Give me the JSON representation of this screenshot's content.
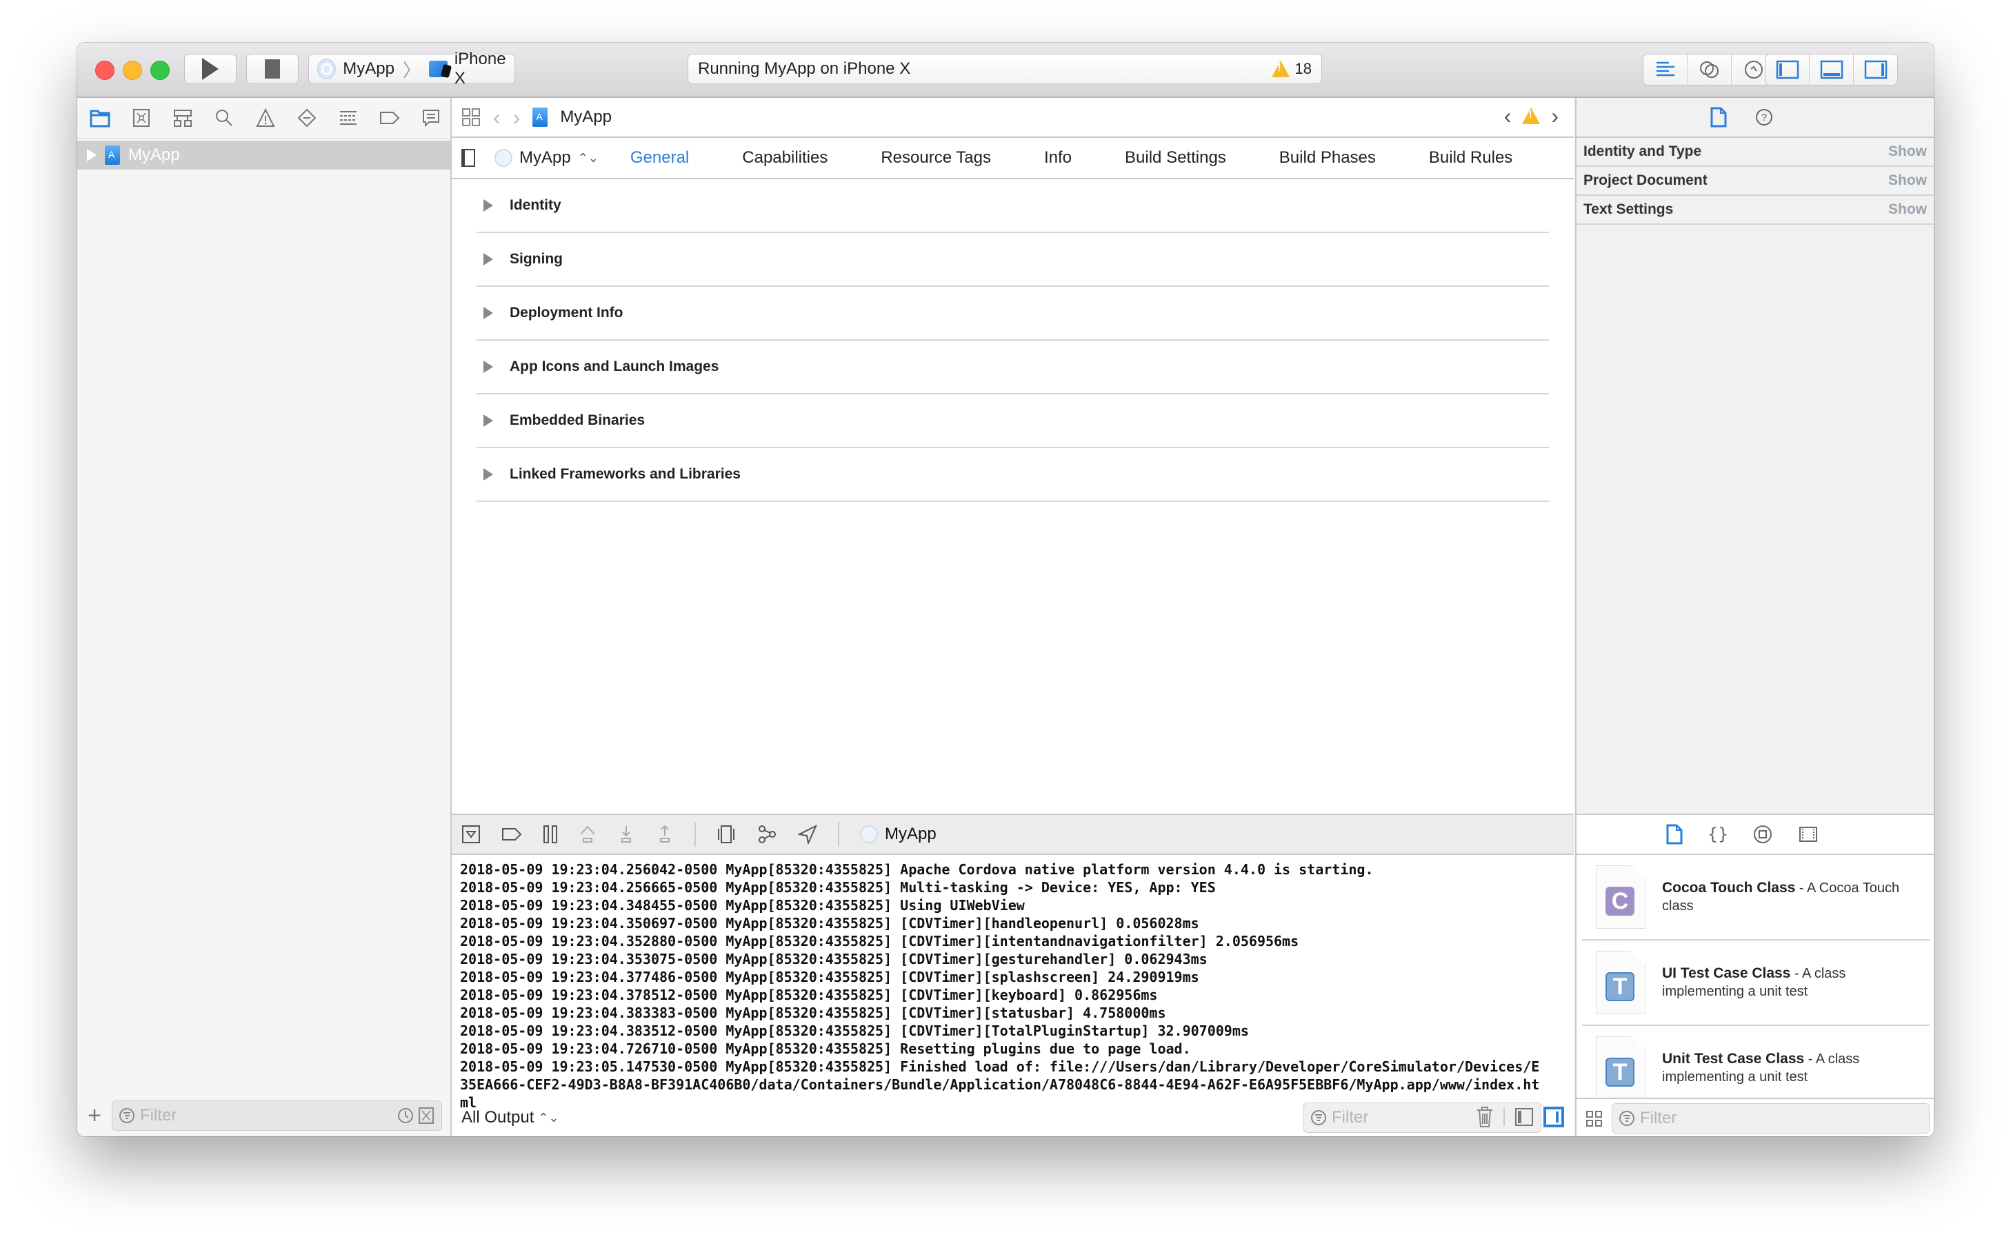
{
  "toolbar": {
    "scheme_target": "MyApp",
    "scheme_device": "iPhone X",
    "status_text": "Running MyApp on iPhone X",
    "warning_count": "18"
  },
  "navigator": {
    "tabs": [
      "project-navigator",
      "source-control-navigator",
      "symbol-navigator",
      "find-navigator",
      "issue-navigator",
      "test-navigator",
      "debug-navigator",
      "breakpoint-navigator",
      "report-navigator"
    ],
    "project_item": "MyApp",
    "filter_placeholder": "Filter"
  },
  "editor": {
    "jumpbar_title": "MyApp",
    "target": "MyApp",
    "tabs": [
      {
        "label": "General",
        "active": true
      },
      {
        "label": "Capabilities",
        "active": false
      },
      {
        "label": "Resource Tags",
        "active": false
      },
      {
        "label": "Info",
        "active": false
      },
      {
        "label": "Build Settings",
        "active": false
      },
      {
        "label": "Build Phases",
        "active": false
      },
      {
        "label": "Build Rules",
        "active": false
      }
    ],
    "sections": [
      "Identity",
      "Signing",
      "Deployment Info",
      "App Icons and Launch Images",
      "Embedded Binaries",
      "Linked Frameworks and Libraries"
    ]
  },
  "inspector": {
    "rows": [
      {
        "label": "Identity and Type",
        "action": "Show"
      },
      {
        "label": "Project Document",
        "action": "Show"
      },
      {
        "label": "Text Settings",
        "action": "Show"
      }
    ]
  },
  "debug": {
    "process": "MyApp",
    "console_lines": [
      "2018-05-09 19:23:04.256042-0500 MyApp[85320:4355825] Apache Cordova native platform version 4.4.0 is starting.",
      "2018-05-09 19:23:04.256665-0500 MyApp[85320:4355825] Multi-tasking -> Device: YES, App: YES",
      "2018-05-09 19:23:04.348455-0500 MyApp[85320:4355825] Using UIWebView",
      "2018-05-09 19:23:04.350697-0500 MyApp[85320:4355825] [CDVTimer][handleopenurl] 0.056028ms",
      "2018-05-09 19:23:04.352880-0500 MyApp[85320:4355825] [CDVTimer][intentandnavigationfilter] 2.056956ms",
      "2018-05-09 19:23:04.353075-0500 MyApp[85320:4355825] [CDVTimer][gesturehandler] 0.062943ms",
      "2018-05-09 19:23:04.377486-0500 MyApp[85320:4355825] [CDVTimer][splashscreen] 24.290919ms",
      "2018-05-09 19:23:04.378512-0500 MyApp[85320:4355825] [CDVTimer][keyboard] 0.862956ms",
      "2018-05-09 19:23:04.383383-0500 MyApp[85320:4355825] [CDVTimer][statusbar] 4.758000ms",
      "2018-05-09 19:23:04.383512-0500 MyApp[85320:4355825] [CDVTimer][TotalPluginStartup] 32.907009ms",
      "2018-05-09 19:23:04.726710-0500 MyApp[85320:4355825] Resetting plugins due to page load.",
      "2018-05-09 19:23:05.147530-0500 MyApp[85320:4355825] Finished load of: file:///Users/dan/Library/Developer/CoreSimulator/Devices/E35EA666-CEF2-49D3-B8A8-BF391AC406B0/data/Containers/Bundle/Application/A78048C6-8844-4E94-A62F-E6A95F5EBBF6/MyApp.app/www/index.html"
    ],
    "output_filter": "All Output",
    "filter_placeholder": "Filter"
  },
  "library": {
    "items": [
      {
        "badge": "C",
        "title": "Cocoa Touch Class",
        "desc": " - A Cocoa Touch class",
        "color": "#a18fc7"
      },
      {
        "badge": "T",
        "title": "UI Test Case Class",
        "desc": " - A class implementing a unit test",
        "color": "#86acd6"
      },
      {
        "badge": "T",
        "title": "Unit Test Case Class",
        "desc": " - A class implementing a unit test",
        "color": "#86acd6"
      }
    ],
    "filter_placeholder": "Filter"
  },
  "colors": {
    "accent": "#2b7fd8",
    "warning": "#f7b824"
  }
}
